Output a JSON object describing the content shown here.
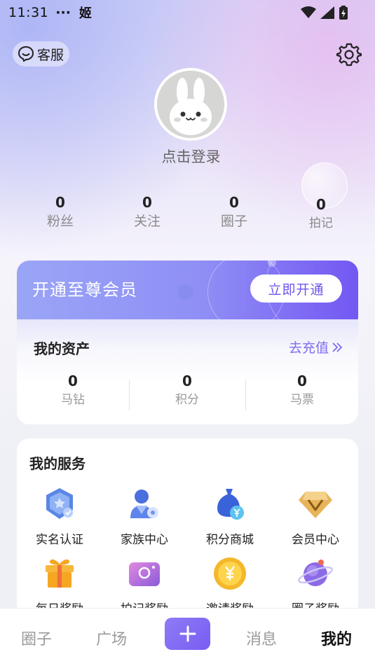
{
  "status_bar": {
    "time": "11:31",
    "dots": "···",
    "app_glyph": "姬"
  },
  "header": {
    "service_label": "客服",
    "login_text": "点击登录"
  },
  "stats": [
    {
      "value": "0",
      "label": "粉丝"
    },
    {
      "value": "0",
      "label": "关注"
    },
    {
      "value": "0",
      "label": "圈子"
    },
    {
      "value": "0",
      "label": "拍记"
    }
  ],
  "vip": {
    "title": "开通至尊会员",
    "button": "立即开通"
  },
  "assets": {
    "title": "我的资产",
    "recharge": "去充值",
    "items": [
      {
        "value": "0",
        "label": "马钻"
      },
      {
        "value": "0",
        "label": "积分"
      },
      {
        "value": "0",
        "label": "马票"
      }
    ]
  },
  "services": {
    "title": "我的服务",
    "items": [
      {
        "label": "实名认证",
        "icon": "verify-shield-icon"
      },
      {
        "label": "家族中心",
        "icon": "family-user-icon"
      },
      {
        "label": "积分商城",
        "icon": "points-bag-icon"
      },
      {
        "label": "会员中心",
        "icon": "vip-diamond-icon"
      },
      {
        "label": "每日奖励",
        "icon": "gift-box-icon"
      },
      {
        "label": "拍记奖励",
        "icon": "camera-icon"
      },
      {
        "label": "邀请奖励",
        "icon": "coin-icon"
      },
      {
        "label": "圈子奖励",
        "icon": "planet-icon"
      }
    ]
  },
  "tabbar": {
    "tabs": [
      "圈子",
      "广场",
      "消息",
      "我的"
    ],
    "active": "我的"
  },
  "colors": {
    "accent": "#7a5cf2",
    "vip_gradient_start": "#9aa5f6",
    "vip_gradient_end": "#7357f3",
    "recharge": "#7a6cf0"
  }
}
